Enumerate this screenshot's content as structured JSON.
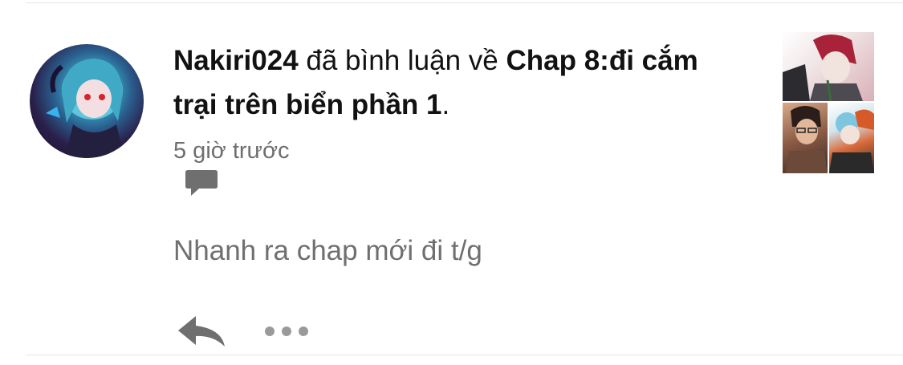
{
  "notification": {
    "username": "Nakiri024",
    "action_text": " đã bình luận về ",
    "chapter_title": "Chap 8:đi cắm trại trên biển phần 1",
    "end_punct": ".",
    "timestamp": "5 giờ trước"
  },
  "comment": {
    "text": "Nhanh ra chap mới đi t/g"
  },
  "icons": {
    "comment": "speech-bubble-icon",
    "reply": "reply-arrow-icon",
    "more": "more-dots-icon"
  },
  "colors": {
    "primary_text": "#121212",
    "secondary_text": "#6f6f6f",
    "icon_gray": "#6f6f6f",
    "divider": "#e6e6e6"
  }
}
